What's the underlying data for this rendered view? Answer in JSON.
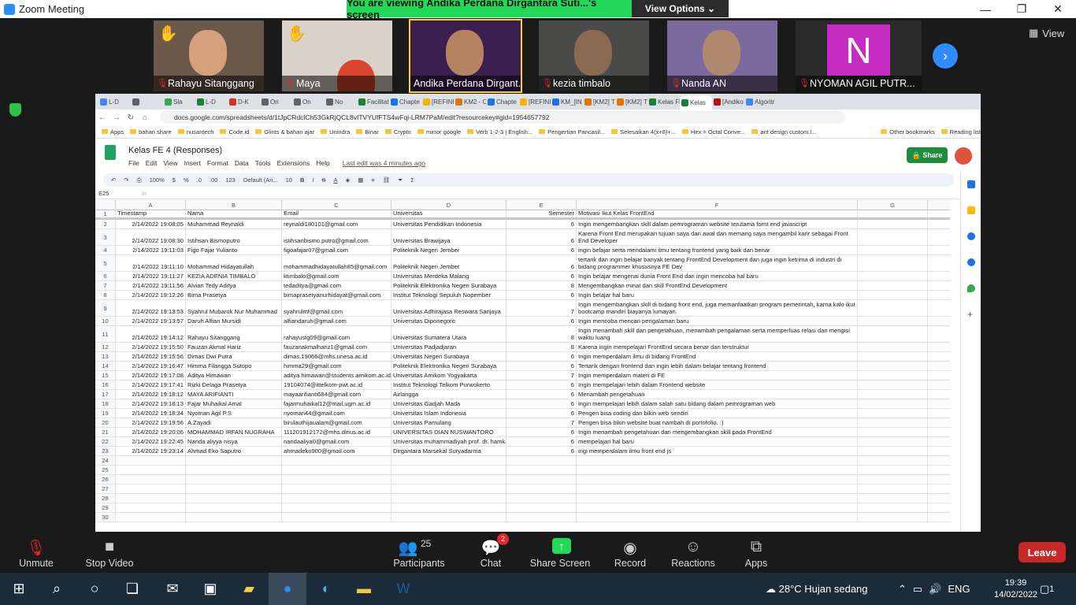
{
  "zoom": {
    "window_title": "Zoom Meeting",
    "banner_message": "You are viewing Andika Perdana Dirgantara Suti...'s screen",
    "view_options": "View Options",
    "view_label": "View",
    "participants": [
      {
        "name": "Rahayu Sitanggang",
        "hand": true
      },
      {
        "name": "Maya",
        "hand": true
      },
      {
        "name": "Andika Perdana Dirgant...",
        "hand": false
      },
      {
        "name": "kezia timbalo",
        "hand": false
      },
      {
        "name": "Nanda AN",
        "hand": false
      },
      {
        "name": "NYOMAN AGIL PUTR...",
        "hand": false,
        "avatar_letter": "N"
      }
    ],
    "controls": {
      "unmute": "Unmute",
      "stop_video": "Stop Video",
      "participants": "Participants",
      "participants_count": "25",
      "chat": "Chat",
      "chat_badge": "2",
      "share_screen": "Share Screen",
      "record": "Record",
      "reactions": "Reactions",
      "apps": "Apps",
      "leave": "Leave"
    }
  },
  "browser": {
    "tabs": [
      "L-D",
      "",
      "Sla",
      "L-D",
      "D-K",
      "On",
      "On",
      "No",
      "Facilitat",
      "Chapte",
      "[REFINI",
      "KM2 - C",
      "Chapte",
      "[REFINI",
      "KM_[IN",
      "[KM2] T",
      "[KM2] T",
      "Kelas Fl",
      "Kelas",
      "[Andiko",
      "Algoritr"
    ],
    "url": "docs.google.com/spreadsheets/d/1tJpCRdclCh53GkRjQCL8vITVYUfFTS4wFqi-LRM7PaM/edit?resourcekey#gid=1954657792",
    "bookmarks": [
      "Apps",
      "bahan share",
      "nusantech",
      "Code.id",
      "Glints & bahan ajar",
      "Unindra",
      "Binar",
      "Crypto",
      "mirror google",
      "Verb 1-2-3 | English...",
      "Pengertian Pancasil...",
      "Selesaikan 4(x+8)+...",
      "Hex = Octal Conve...",
      "ant design custom.l...",
      "Other bookmarks",
      "Reading list"
    ]
  },
  "sheet": {
    "title": "Kelas FE 4 (Responses)",
    "menus": [
      "File",
      "Edit",
      "View",
      "Insert",
      "Format",
      "Data",
      "Tools",
      "Extensions",
      "Help"
    ],
    "last_edit": "Last edit was 4 minutes ago",
    "share": "Share",
    "toolbar": {
      "zoom": "100%",
      "currency": "$",
      "percent": "%",
      "dec0": ".0",
      "dec00": ".00",
      "fmt": "123",
      "font": "Default (Ari...",
      "size": "10"
    },
    "cell_ref": "E25",
    "columns": [
      "A",
      "B",
      "C",
      "D",
      "E",
      "F",
      "G"
    ],
    "headers": [
      "Timestamp",
      "Nama",
      "Email",
      "Universitas",
      "Semester",
      "Motivasi Ikut Kelas FrontEnd",
      ""
    ],
    "rows": [
      [
        "2/14/2022 19:08:05",
        "Muhammad Reynaldi",
        "reynaldi180101@gmail.com",
        "Universitas Pendidikan Indonesia",
        "6",
        "Ingin mengembangkan skill dalam pemrograman website terutama fornt end javascript"
      ],
      [
        "2/14/2022 19:08:30",
        "Istihsan Bismoputro",
        "istihsanbismo.putro@gmail.com",
        "Universitas Brawijaya",
        "6",
        "Karena Front End merupakan tujuan saya dari awal dan memang saya mengambil karir sebagai Front End Developer"
      ],
      [
        "2/14/2022 19:11:03",
        "Figo Fajar Yulianto",
        "figoafajar07@gmail.com",
        "Politeknik Negeri Jember",
        "6",
        "ingin belajar serta mendalami ilmu tentang frontend yang baik dan benar"
      ],
      [
        "2/14/2022 19:11:10",
        "Mohammad Hidayatullah",
        "mohammadhidayatullah85@gmail.com",
        "Politeknik Negeri Jember",
        "6",
        "tertarik dan ingin belajar banyak tentang FrontEnd Development dan juga ingin ketrima di industri di bidang programmer khususnya FE Dev"
      ],
      [
        "2/14/2022 19:11:27",
        "KEZIA ADENIA TIMBALO",
        "ktimbalo@gmail.com",
        "Universitas Merdeka Malang",
        "6",
        "Ingin belajar mengenai dunia Front End dan ingin mencoba hal baru"
      ],
      [
        "2/14/2022 19:11:56",
        "Alvian Tedy Aditya",
        "tedaditya@gmail.com",
        "Politeknik Elektronika Negeri Surabaya",
        "8",
        "Mengembangkan minat dan skill FrontEnd Development"
      ],
      [
        "2/14/2022 19:12:26",
        "Bima Prasetya",
        "bimaprasetyanurhidayat@gmail.com",
        "Institut Teknologi Sepuluh Nopember",
        "6",
        "Ingin belajar hal baru"
      ],
      [
        "2/14/2022 19:13:53",
        "Syahrul Mubarok Nur Muhammad",
        "syahrulmf@gmail.com",
        "Universitas Adhirajasa Reswara Sanjaya",
        "7",
        "Ingin mengembangkan skill di bidang front end, juga memanfaatkan program pemerintah, karna kalo ikut bootcamp mandiri biayanya lumayan."
      ],
      [
        "2/14/2022 19:13:57",
        "Daruh Alfian Mursidi",
        "alfiandaruh@gmail.com",
        "Universitas Diponegoro",
        "6",
        "Ingin mencoba mencari pengalaman baru"
      ],
      [
        "2/14/2022 19:14:12",
        "Rahayu Sitanggang",
        "rahayustg09@gmail.com",
        "Universitas Sumatera Utara",
        "8",
        "Ingin menambah skill dan pengetahuan, menambah pengalaman serta memperluas relasi dan mengisi waktu luang"
      ],
      [
        "2/14/2022 19:15:50",
        "Fauzan Akmal Hariz",
        "fauzanakmalhariz1@gmail.com",
        "Universitas Padjadjaran",
        "8",
        "Karena ingin mempelajari FrontEnd secara benar dan terstruktur"
      ],
      [
        "2/14/2022 19:15:56",
        "Dimas Dwi Putra",
        "dimas.19066@mhs.unesa.ac.id",
        "Universitas Negeri Surabaya",
        "6",
        "Ingin memperdalam ilmu di bidang FrontEnd"
      ],
      [
        "2/14/2022 19:16:47",
        "Himma Filangga Sutopo",
        "himma29@gmail.com",
        "Politeknik Elektronika Negeri Surabaya",
        "6",
        "Tertarik dengan frontend dan ingin lebih dalam belajar tentang frontend"
      ],
      [
        "2/14/2022 19:17:08",
        "Aditya Himawan",
        "aditya.himawan@students.amikom.ac.id",
        "Universitas Amikom Yogyakarta",
        "7",
        "Ingin memperdalam materi di FE"
      ],
      [
        "2/14/2022 19:17:41",
        "Rizki Delaga Prasetya",
        "19104074@ittelkom-pwt.ac.id",
        "Institut Teknologi Telkom Purwokerto",
        "6",
        "Ingin mempelajari lebih dalam Frontend website"
      ],
      [
        "2/14/2022 19:18:12",
        "MAYA ARIFIANTI",
        "mayaarifianti684@gmail.com",
        "Airlangga",
        "6",
        "Menambah pengetahuan"
      ],
      [
        "2/14/2022 19:18:13",
        "Fajar Muhaikal Amal",
        "fajarmuhaikal12@mail.ugm.ac.id",
        "Universitas Gadjah Mada",
        "6",
        "ingin mempelajari lebih dalam salah satu bidang dalam pemrograman web"
      ],
      [
        "2/14/2022 19:18:34",
        "Nyoman Agil P.S",
        "nyoman44@gmail.com",
        "Universitas Islam Indonesia",
        "6",
        "Pengen bisa coding dan bikin web sendiri"
      ],
      [
        "2/14/2022 19:19:56",
        "A.Zayadi",
        "birulauthijaualam@gmail.com",
        "Universitas Pamulang",
        "7",
        "Pengen bisa bikin website buat nambah di portofolio. :)"
      ],
      [
        "2/14/2022 19:20:06",
        "MOHAMMAD IRFAN NUGRAHA",
        "111201912172@mhs.dinus.ac.id",
        "UNIVERSITAS DIAN NUSWANTORO",
        "6",
        "Ingin menambah pengetahuan dan mengembangkan skill pada FrontEnd"
      ],
      [
        "2/14/2022 19:22:45",
        "Nanda aliyya nisya",
        "nandaaliya0@gmail.com",
        "Universitas muhammadiyah prof. dr. hamka",
        "6",
        "mempelajari hal baru"
      ],
      [
        "2/14/2022 19:23:14",
        "Ahmad Eko Saputro",
        "ahmadeko900@gmail.com",
        "Dirgantara Marsekal Suryadarma",
        "6",
        "ingi memperdalam ilmu front end js"
      ]
    ],
    "empty_rows": [
      "24",
      "25",
      "26",
      "27",
      "28",
      "29",
      "30"
    ]
  },
  "taskbar": {
    "weather": "28°C  Hujan sedang",
    "lang": "ENG",
    "time": "19:39",
    "date": "14/02/2022",
    "notif": "1"
  }
}
